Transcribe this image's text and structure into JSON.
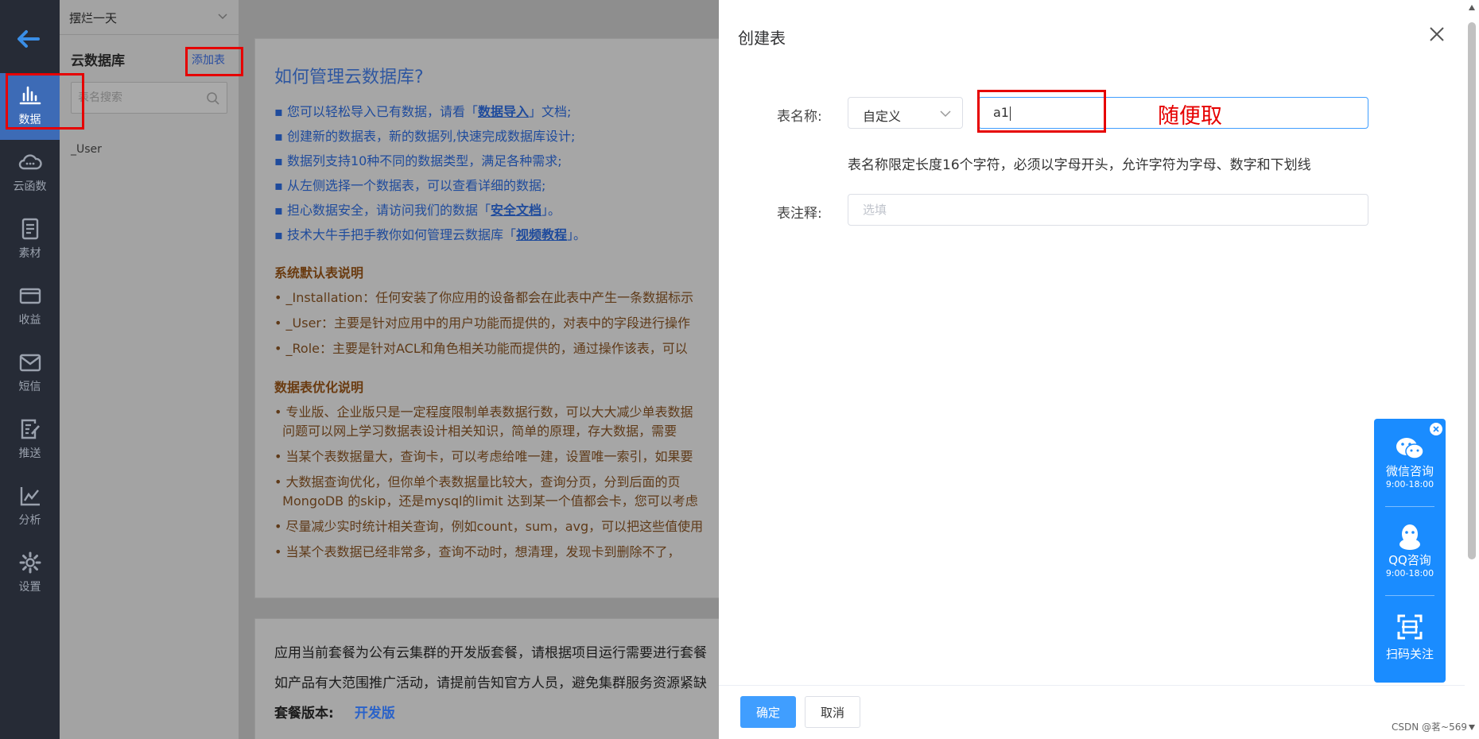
{
  "sidebar": {
    "items": [
      {
        "label": "数据",
        "icon": "bar-chart-icon"
      },
      {
        "label": "云函数",
        "icon": "cloud-icon"
      },
      {
        "label": "素材",
        "icon": "document-icon"
      },
      {
        "label": "收益",
        "icon": "card-icon"
      },
      {
        "label": "短信",
        "icon": "mail-icon"
      },
      {
        "label": "推送",
        "icon": "edit-doc-icon"
      },
      {
        "label": "分析",
        "icon": "line-chart-icon"
      },
      {
        "label": "设置",
        "icon": "gear-icon"
      }
    ]
  },
  "left_panel": {
    "app_name": "摆烂一天",
    "db_title": "云数据库",
    "add_table": "添加表",
    "search_placeholder": "表名搜索",
    "tables": [
      "_User"
    ]
  },
  "help": {
    "title": "如何管理云数据库?",
    "lines": [
      {
        "pre": "您可以轻松导入已有数据，请看「",
        "link": "数据导入",
        "post": "」文档;"
      },
      {
        "pre": "创建新的数据表，新的数据列,快速完成数据库设计;",
        "link": "",
        "post": ""
      },
      {
        "pre": "数据列支持10种不同的数据类型，满足各种需求;",
        "link": "",
        "post": ""
      },
      {
        "pre": "从左侧选择一个数据表，可以查看详细的数据;",
        "link": "",
        "post": ""
      },
      {
        "pre": "担心数据安全，请访问我们的数据「",
        "link": "安全文档",
        "post": "」。"
      },
      {
        "pre": "技术大牛手把手教你如何管理云数据库「",
        "link": "视频教程",
        "post": "」。"
      }
    ],
    "sys_title": "系统默认表说明",
    "sys_lines": [
      "_Installation：任何安装了你应用的设备都会在此表中产生一条数据标示",
      "_User：主要是针对应用中的用户功能而提供的，对表中的字段进行操作",
      "_Role：主要是针对ACL和角色相关功能而提供的，通过操作该表，可以"
    ],
    "opt_title": "数据表优化说明",
    "opt_lines": [
      "专业版、企业版只是一定程度限制单表数据行数，可以大大减少单表数据",
      "问题可以网上学习数据表设计相关知识，简单的原理，存大数据，需要",
      "当某个表数据量大，查询卡，可以考虑给唯一建，设置唯一索引，如果要",
      "大数据查询优化，但你单个表数据量比较大，查询分页，分到后面的页",
      "MongoDB 的skip，还是mysql的limit 达到某一个值都会卡，您可以考虑",
      "尽量减少实时统计相关查询，例如count，sum，avg，可以把这些值使用",
      "当某个表数据已经非常多，查询不动时，想清理，发现卡到删除不了，"
    ]
  },
  "plan": {
    "line1": "应用当前套餐为公有云集群的开发版套餐，请根据项目运行需要进行套餐",
    "line2": "如产品有大范围推广活动，请提前告知官方人员，避免集群服务资源紧缺",
    "version_label": "套餐版本:",
    "version_value": "开发版"
  },
  "dialog": {
    "title": "创建表",
    "name_label": "表名称:",
    "type_value": "自定义",
    "name_value": "a1",
    "annotation": "随便取",
    "hint": "表名称限定长度16个字符，必须以字母开头，允许字符为字母、数字和下划线",
    "note_label": "表注释:",
    "note_placeholder": "选填",
    "ok": "确定",
    "cancel": "取消"
  },
  "float_widget": {
    "wechat_label": "微信咨询",
    "wechat_time": "9:00-18:00",
    "qq_label": "QQ咨询",
    "qq_time": "9:00-18:00",
    "scan_label": "扫码关注"
  },
  "watermark": "CSDN @茗~569"
}
